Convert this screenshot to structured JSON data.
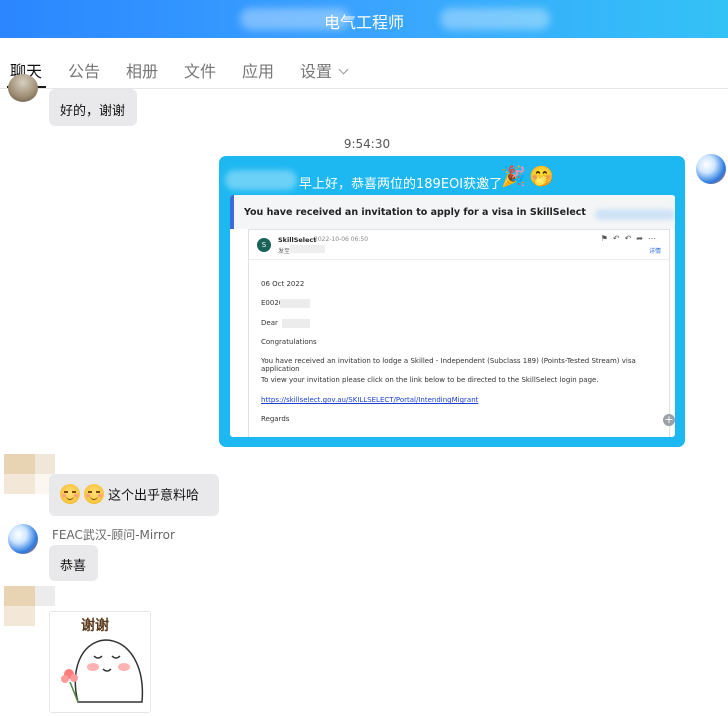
{
  "window": {
    "title": "电气工程师"
  },
  "tabs": [
    {
      "label": "聊天"
    },
    {
      "label": "公告"
    },
    {
      "label": "相册"
    },
    {
      "label": "文件"
    },
    {
      "label": "应用"
    },
    {
      "label": "设置"
    }
  ],
  "messages": {
    "m1": {
      "text": "好的，谢谢"
    },
    "time1": "9:54:30",
    "m2": {
      "text": "早上好，恭喜两位的189EOI获邀了",
      "email": {
        "subject": "You have received an invitation to apply for a visa in SkillSelect",
        "sender_initial": "S",
        "sender": "SkillSelect",
        "date": "2022-10-06 06:50",
        "to_label": "发至",
        "details_label": "详情",
        "lines": {
          "date": "06 Oct 2022",
          "ref": "E0020",
          "dear": "Dear",
          "congrats": "Congratulations",
          "body1": "You have received an invitation to lodge a Skilled - Independent (Subclass 189) (Points-Tested Stream) visa application",
          "body2": "To view your invitation please click on the link below to be directed to the SkillSelect login page.",
          "link": "https://skillselect.gov.au/SKILLSELECT/Portal/IntendingMigrant",
          "regards": "Regards"
        }
      }
    },
    "m3": {
      "text": "这个出乎意料哈"
    },
    "m4": {
      "sender": "FEAC武汉-顾问-Mirror",
      "text": "恭喜"
    },
    "m5": {
      "sticker_text": "谢谢"
    }
  },
  "colors": {
    "header_gradient_start": "#2b86ff",
    "header_gradient_end": "#33c2f6",
    "self_bubble": "#1db8f2",
    "other_bubble": "#e9e9eb"
  }
}
